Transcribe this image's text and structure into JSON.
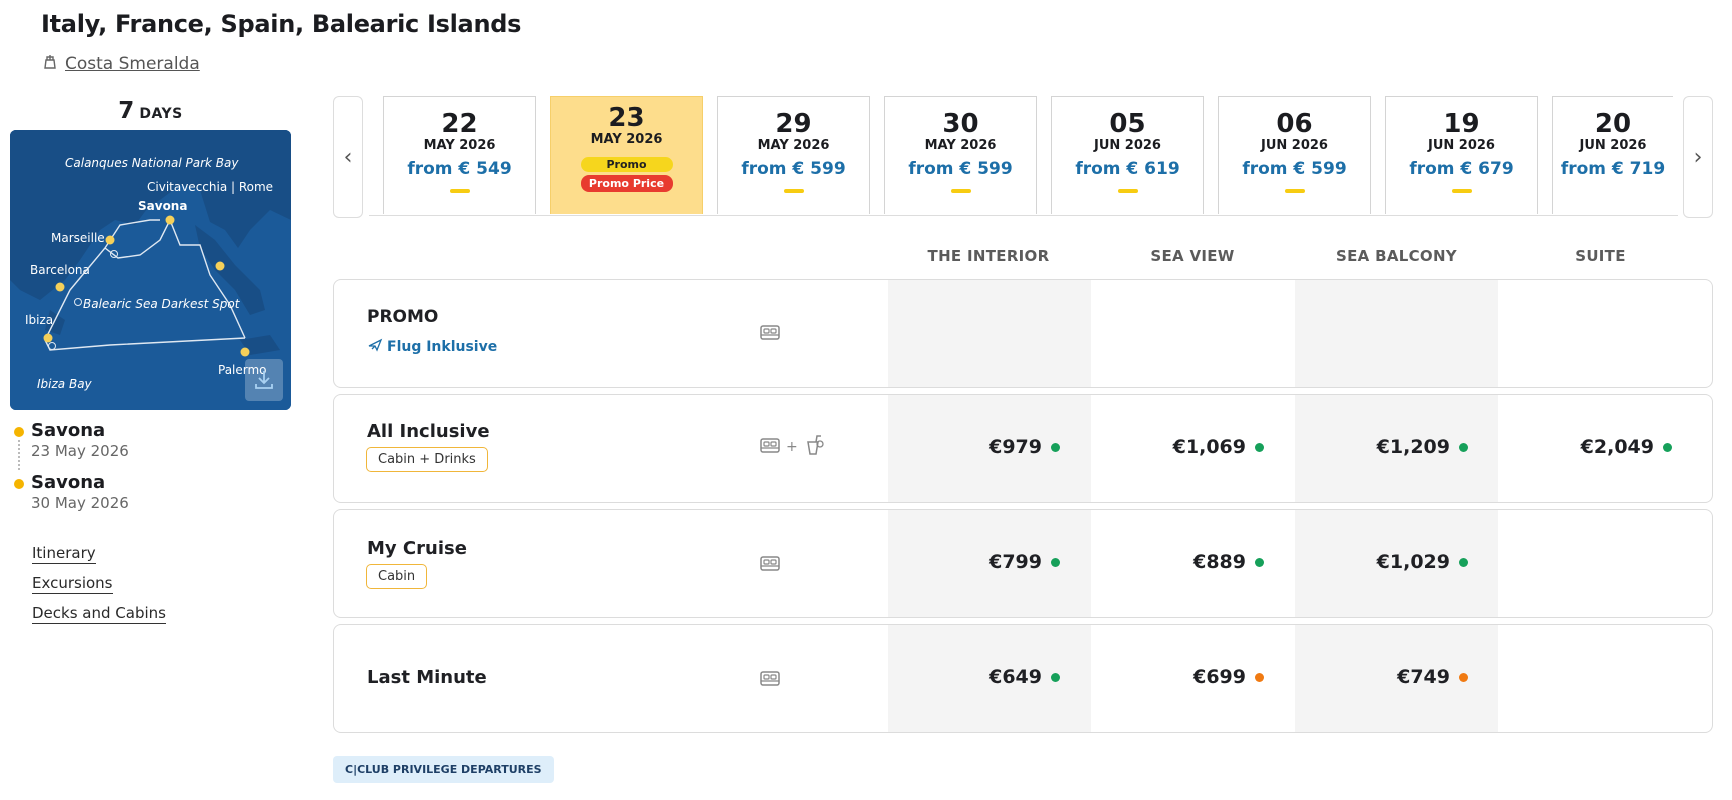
{
  "header": {
    "title": "Italy, France, Spain, Balearic Islands",
    "ship_name": "Costa Smeralda"
  },
  "duration": {
    "number": "7",
    "unit": "DAYS"
  },
  "map": {
    "labels": {
      "calanques": "Calanques National Park Bay",
      "civitavecchia": "Civitavecchia | Rome",
      "savona": "Savona",
      "marseille": "Marseille",
      "barcelona": "Barcelona",
      "balearic": "Balearic Sea Darkest Spot",
      "ibiza": "Ibiza",
      "palermo": "Palermo",
      "ibiza_bay": "Ibiza Bay"
    },
    "download_icon": "download-icon"
  },
  "route": {
    "embark": {
      "port": "Savona",
      "date": "23 May 2026"
    },
    "disembark": {
      "port": "Savona",
      "date": "30 May 2026"
    }
  },
  "links": {
    "itinerary": "Itinerary",
    "excursions": "Excursions",
    "decks": "Decks and Cabins"
  },
  "carousel": {
    "prev": "‹",
    "next": "›",
    "dates": [
      {
        "day": "22",
        "month": "MAY 2026",
        "from": "from € 549"
      },
      {
        "day": "23",
        "month": "MAY 2026",
        "promo": "Promo",
        "promo_price": "Promo Price",
        "selected": true
      },
      {
        "day": "29",
        "month": "MAY 2026",
        "from": "from € 599"
      },
      {
        "day": "30",
        "month": "MAY 2026",
        "from": "from € 599"
      },
      {
        "day": "05",
        "month": "JUN 2026",
        "from": "from € 619"
      },
      {
        "day": "06",
        "month": "JUN 2026",
        "from": "from € 599"
      },
      {
        "day": "19",
        "month": "JUN 2026",
        "from": "from € 679"
      },
      {
        "day": "20",
        "month": "JUN 2026",
        "from": "from € 719"
      }
    ]
  },
  "columns": {
    "interior": "THE INTERIOR",
    "sea_view": "SEA VIEW",
    "balcony": "SEA BALCONY",
    "suite": "SUITE"
  },
  "fares": {
    "promo": {
      "name": "PROMO",
      "flight": "Flug Inklusive"
    },
    "all_inclusive": {
      "name": "All Inclusive",
      "tag": "Cabin + Drinks",
      "plus": "+",
      "interior": "€979",
      "sea_view": "€1,069",
      "balcony": "€1,209",
      "suite": "€2,049"
    },
    "my_cruise": {
      "name": "My Cruise",
      "tag": "Cabin",
      "interior": "€799",
      "sea_view": "€889",
      "balcony": "€1,029"
    },
    "last_minute": {
      "name": "Last Minute",
      "interior": "€649",
      "sea_view": "€699",
      "balcony": "€749"
    }
  },
  "availability_colors": {
    "available": "#16a05a",
    "limited": "#f07a12"
  },
  "cclub": "C|CLUB PRIVILEGE DEPARTURES"
}
